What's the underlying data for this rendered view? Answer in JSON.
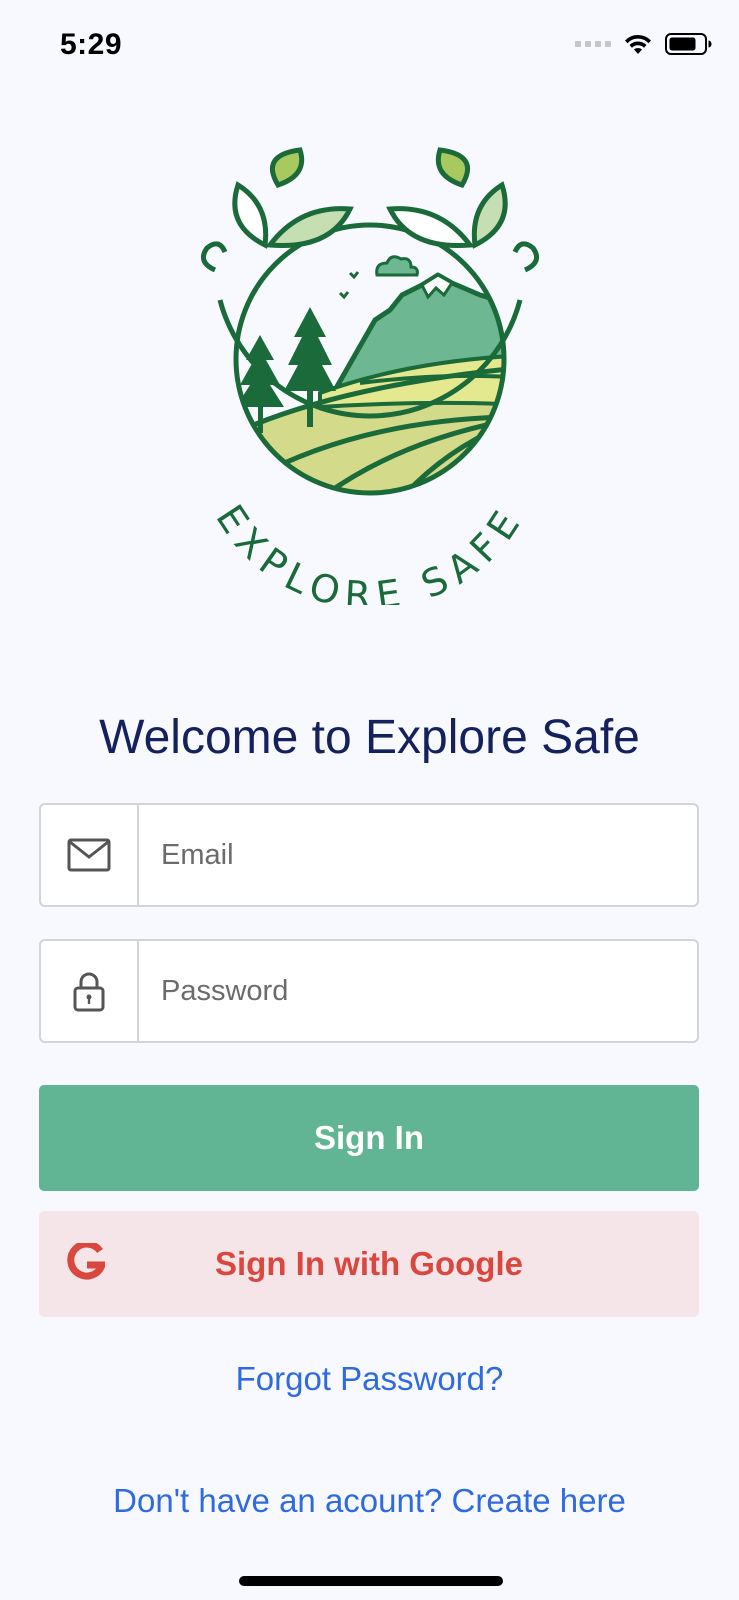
{
  "status_bar": {
    "time": "5:29",
    "icons": [
      "signal-dots-icon",
      "wifi-icon",
      "battery-icon"
    ]
  },
  "logo": {
    "text": "EXPLORE SAFE",
    "colors": {
      "dark_green": "#1B6A3A",
      "light_green": "#A8C95E",
      "pale_green": "#D3DA8A",
      "mountain": "#6DB893"
    }
  },
  "welcome_title": "Welcome to Explore Safe",
  "form": {
    "email": {
      "placeholder": "Email",
      "value": "",
      "icon": "mail-icon"
    },
    "password": {
      "placeholder": "Password",
      "value": "",
      "icon": "lock-icon"
    }
  },
  "buttons": {
    "sign_in": "Sign In",
    "google": "Sign In with Google",
    "google_icon": "google-g-icon"
  },
  "links": {
    "forgot_password": "Forgot Password?",
    "create_account": "Don't have an acount? Create here"
  },
  "colors": {
    "background": "#F7F9FE",
    "title": "#14215C",
    "primary_button": "#62B594",
    "google_button_bg": "#F6E5E8",
    "google_red": "#D9483E",
    "link": "#2F6BE0"
  }
}
